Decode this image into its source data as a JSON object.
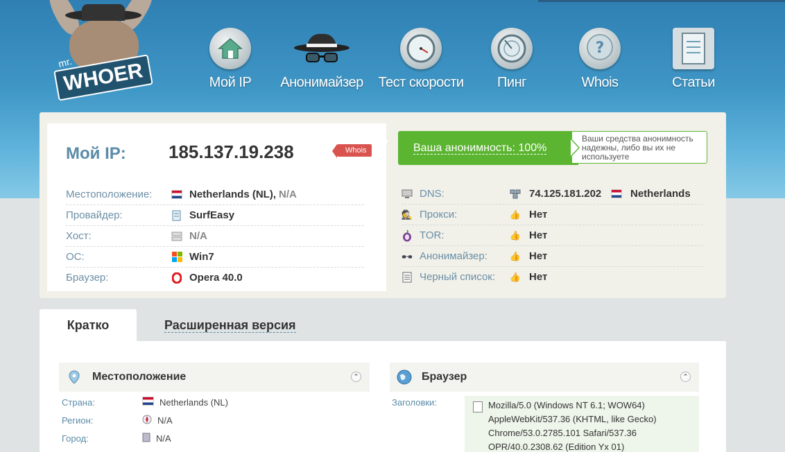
{
  "logo": {
    "mr": "mr.",
    "brand": "WHOER"
  },
  "nav": [
    {
      "label": "Мой IP",
      "icon": "home-icon"
    },
    {
      "label": "Анонимайзер",
      "icon": "spy-hat-icon"
    },
    {
      "label": "Тест скорости",
      "icon": "speedometer-icon"
    },
    {
      "label": "Пинг",
      "icon": "radar-icon"
    },
    {
      "label": "Whois",
      "icon": "question-icon"
    },
    {
      "label": "Статьи",
      "icon": "document-icon"
    }
  ],
  "ip": {
    "label": "Мой IP:",
    "value": "185.137.19.238",
    "whois_tag": "Whois"
  },
  "left_rows": [
    {
      "key": "Местоположение:",
      "value": "Netherlands (NL),",
      "extra": "N/A",
      "icon": "flag-nl-icon"
    },
    {
      "key": "Провайдер:",
      "value": "SurfEasy",
      "icon": "provider-icon"
    },
    {
      "key": "Хост:",
      "value": "N/A",
      "icon": "server-icon"
    },
    {
      "key": "ОС:",
      "value": "Win7",
      "icon": "windows-icon"
    },
    {
      "key": "Браузер:",
      "value": "Opera 40.0",
      "icon": "opera-icon"
    }
  ],
  "anonymity": {
    "label": "Ваша анонимность: 100%",
    "tip": "Ваши средства анонимность надежны, либо вы их не используете",
    "color": "#5cb531"
  },
  "right_rows": [
    {
      "key": "DNS:",
      "value": "74.125.181.202",
      "country": "Netherlands",
      "icon": "dns-icon"
    },
    {
      "key": "Прокси:",
      "value": "Нет",
      "icon": "proxy-icon"
    },
    {
      "key": "TOR:",
      "value": "Нет",
      "icon": "tor-icon"
    },
    {
      "key": "Анонимайзер:",
      "value": "Нет",
      "icon": "glasses-icon"
    },
    {
      "key": "Черный список:",
      "value": "Нет",
      "icon": "list-icon"
    }
  ],
  "tabs": {
    "brief": "Кратко",
    "extended": "Расширенная версия"
  },
  "location_section": {
    "title": "Местоположение",
    "rows": [
      {
        "key": "Страна:",
        "value": "Netherlands (NL)"
      },
      {
        "key": "Регион:",
        "value": "N/A"
      },
      {
        "key": "Город:",
        "value": "N/A"
      }
    ]
  },
  "browser_section": {
    "title": "Браузер",
    "headers_label": "Заголовки:",
    "ua_lines": [
      "Mozilla/5.0 (Windows NT 6.1; WOW64)",
      "AppleWebKit/537.36 (KHTML, like Gecko)",
      "Chrome/53.0.2785.101 Safari/537.36",
      "OPR/40.0.2308.62 (Edition Yx 01)"
    ]
  }
}
